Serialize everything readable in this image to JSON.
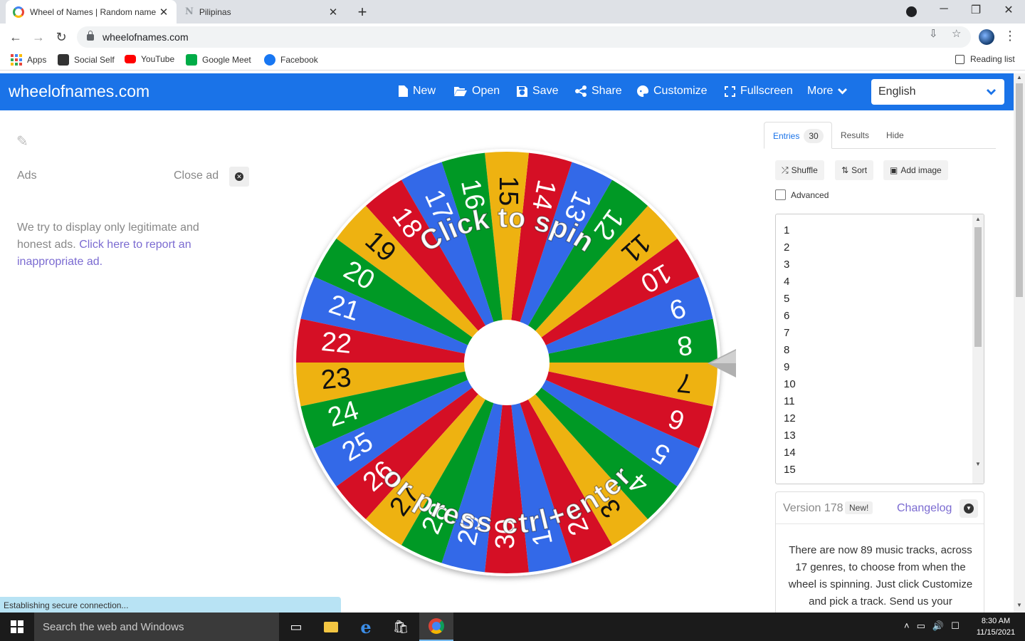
{
  "browser": {
    "tabs": [
      {
        "title": "Wheel of Names | Random name picker",
        "active": true
      },
      {
        "title": "Pilipinas",
        "active": false
      }
    ],
    "url": "wheelofnames.com",
    "bookmarks": [
      "Apps",
      "Social Self",
      "YouTube",
      "Google Meet",
      "Facebook"
    ],
    "reading_list": "Reading list"
  },
  "header": {
    "brand": "wheelofnames.com",
    "nav": [
      "New",
      "Open",
      "Save",
      "Share",
      "Customize",
      "Fullscreen",
      "More"
    ],
    "language": "English"
  },
  "ad": {
    "label": "Ads",
    "close_label": "Close ad",
    "text": "We try to display only legitimate and honest ads.",
    "link": "Click here to report an inappropriate ad."
  },
  "wheel": {
    "segments": [
      "1",
      "2",
      "3",
      "4",
      "5",
      "6",
      "7",
      "8",
      "9",
      "10",
      "11",
      "12",
      "13",
      "14",
      "15",
      "16",
      "17",
      "18",
      "19",
      "20",
      "21",
      "22",
      "23",
      "24",
      "25",
      "26",
      "27",
      "28",
      "29",
      "30"
    ],
    "colors": [
      "#3369e8",
      "#d50f25",
      "#eeb211",
      "#009925"
    ],
    "top_text": "Click to spin",
    "bottom_text": "or press ctrl+enter"
  },
  "entries_panel": {
    "tabs": {
      "entries": "Entries",
      "count": "30",
      "results": "Results",
      "hide": "Hide"
    },
    "buttons": {
      "shuffle": "Shuffle",
      "sort": "Sort",
      "add_image": "Add image"
    },
    "advanced": "Advanced",
    "entries": [
      "1",
      "2",
      "3",
      "4",
      "5",
      "6",
      "7",
      "8",
      "9",
      "10",
      "11",
      "12",
      "13",
      "14",
      "15"
    ]
  },
  "version": {
    "label": "Version 178",
    "badge": "New!",
    "changelog": "Changelog",
    "body": "There are now 89 music tracks, across 17 genres, to choose from when the wheel is spinning. Just click Customize and pick a track. Send us your"
  },
  "status": "Establishing secure connection...",
  "taskbar": {
    "search": "Search the web and Windows",
    "time": "8:30 AM",
    "date": "11/15/2021"
  }
}
